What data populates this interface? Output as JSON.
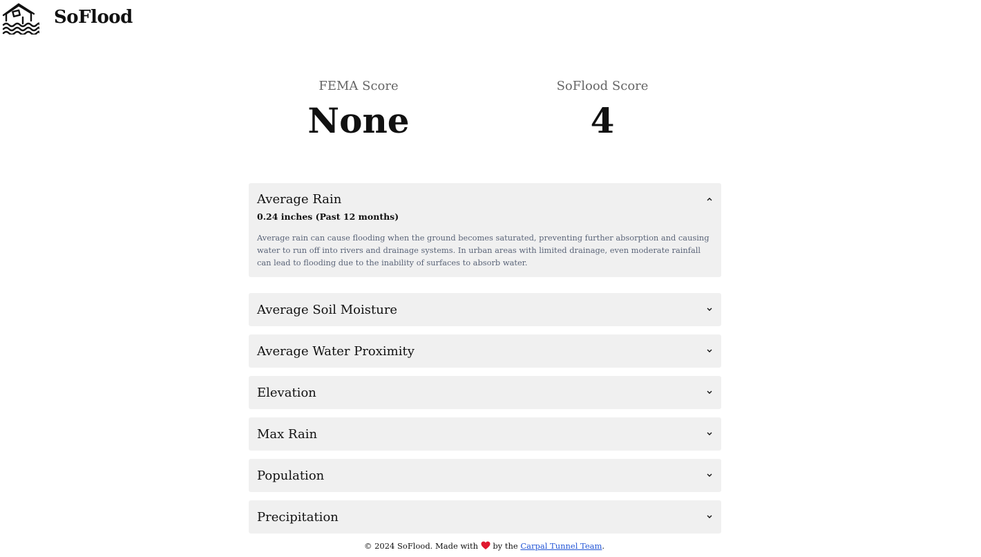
{
  "brand": {
    "name": "SoFlood",
    "logo_icon": "flooded-house-icon"
  },
  "scores": {
    "fema": {
      "label": "FEMA Score",
      "value": "None"
    },
    "soflood": {
      "label": "SoFlood Score",
      "value": "4"
    }
  },
  "accordions": [
    {
      "title": "Average Rain",
      "expanded": true,
      "value": "0.24 inches (Past 12 months)",
      "description": "Average rain can cause flooding when the ground becomes saturated, preventing further absorption and causing water to run off into rivers and drainage systems. In urban areas with limited drainage, even moderate rainfall can lead to flooding due to the inability of surfaces to absorb water."
    },
    {
      "title": "Average Soil Moisture",
      "expanded": false
    },
    {
      "title": "Average Water Proximity",
      "expanded": false
    },
    {
      "title": "Elevation",
      "expanded": false
    },
    {
      "title": "Max Rain",
      "expanded": false
    },
    {
      "title": "Population",
      "expanded": false
    },
    {
      "title": "Precipitation",
      "expanded": false
    }
  ],
  "footer": {
    "prefix": "© 2024 SoFlood. Made with",
    "heart_icon": "heart-icon",
    "middle": "by the",
    "link_text": "Carpal Tunnel Team",
    "suffix": ".",
    "link_color": "#2255d6"
  },
  "colors": {
    "panel_bg": "#f0f0f0",
    "description_text": "#5a6478",
    "score_label": "#666666"
  }
}
